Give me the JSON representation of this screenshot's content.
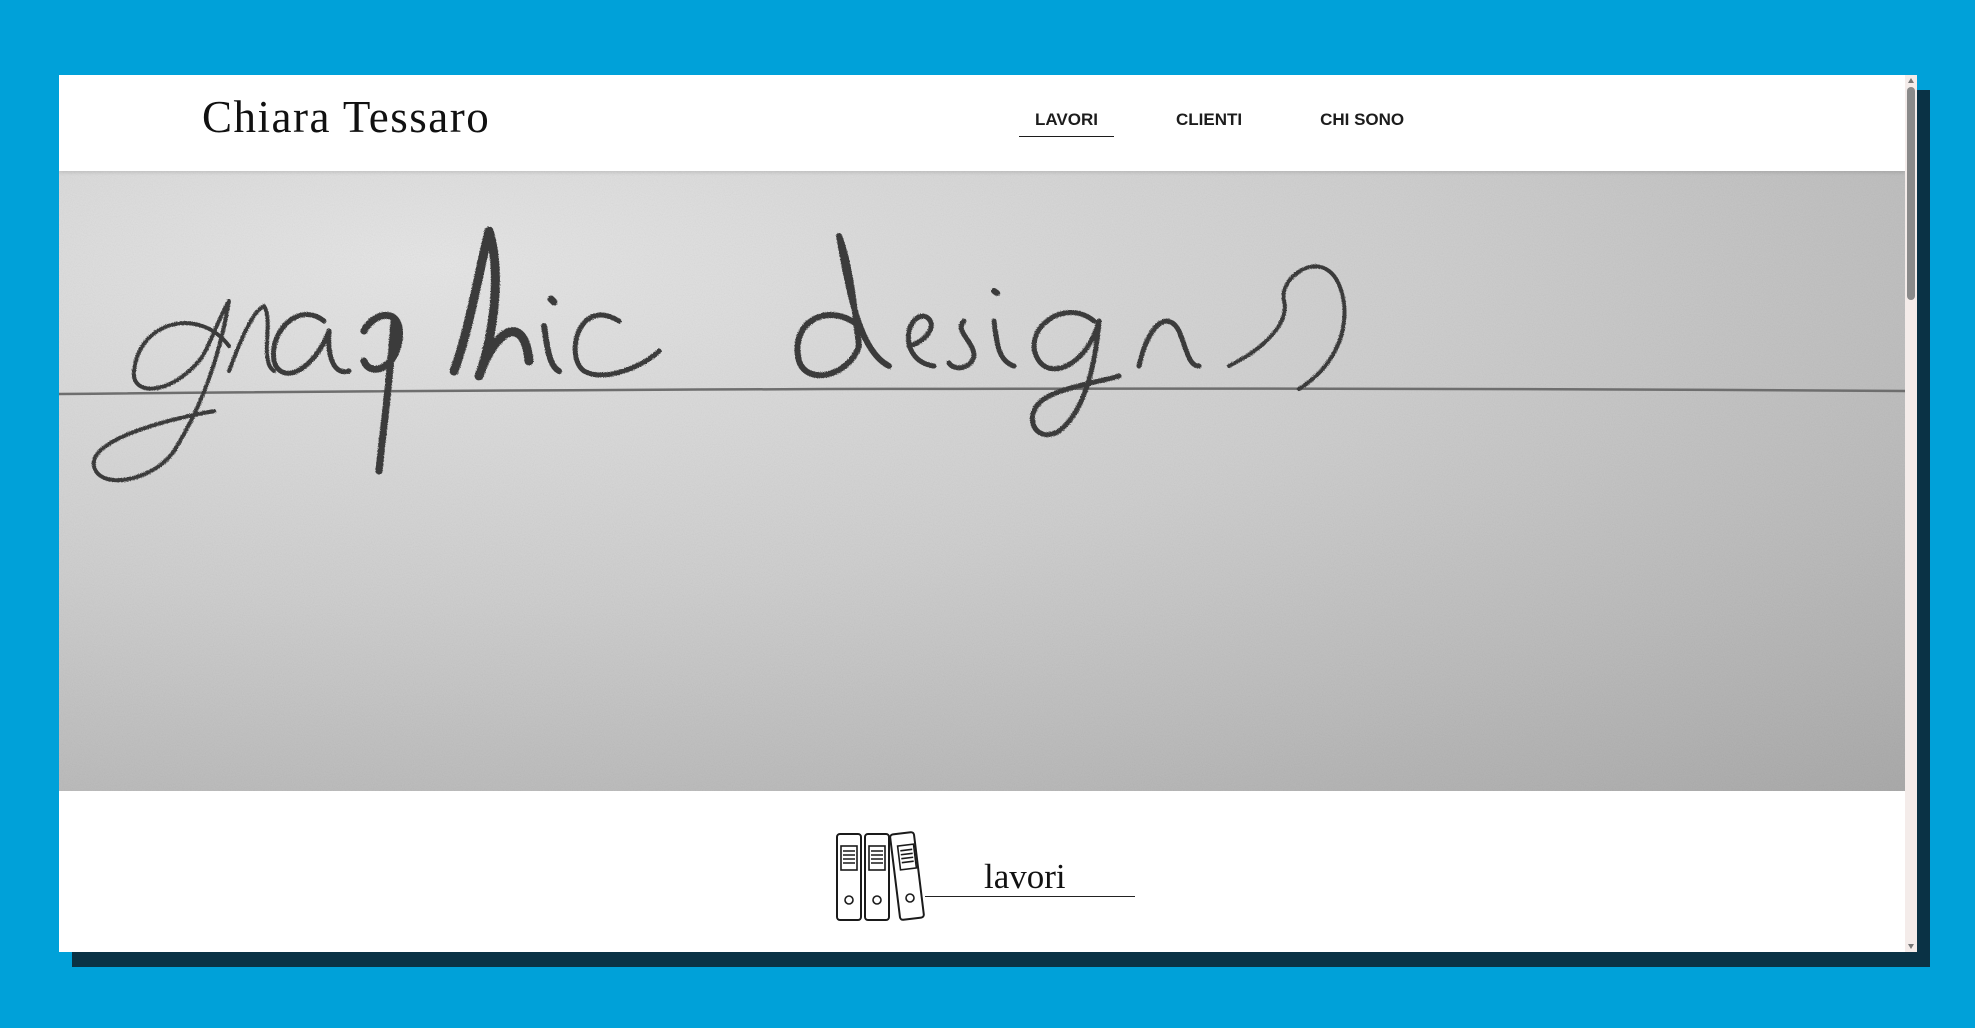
{
  "site": {
    "brand": "Chiara Tessaro"
  },
  "nav": {
    "items": [
      {
        "label": "LAVORI",
        "active": true
      },
      {
        "label": "CLIENTI",
        "active": false
      },
      {
        "label": "CHI SONO",
        "active": false
      }
    ]
  },
  "hero": {
    "handwritten_text": "graphic design",
    "image_style": "grayscale pencil handwriting on paper"
  },
  "section": {
    "title": "lavori",
    "icon": "binders-icon"
  },
  "colors": {
    "page_background": "#00a1d9",
    "window_shadow": "#0a3245",
    "window_background": "#ffffff",
    "text": "#111111",
    "scrollbar_track": "#f4ecea"
  }
}
